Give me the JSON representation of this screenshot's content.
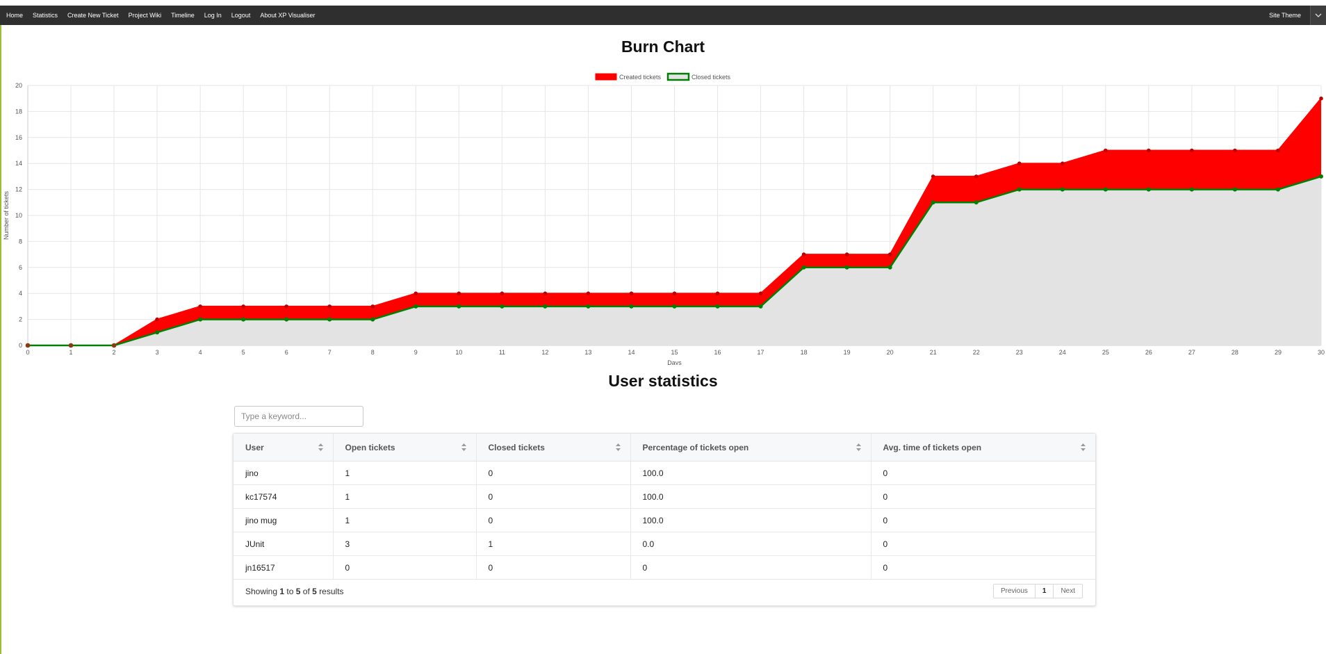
{
  "nav": {
    "items": [
      "Home",
      "Statistics",
      "Create New Ticket",
      "Project Wiki",
      "Timeline",
      "Log In",
      "Logout",
      "About XP Visualiser"
    ],
    "theme_label": "Site Theme"
  },
  "burn_title": "Burn Chart",
  "chart_data": {
    "type": "area",
    "xlabel": "Days",
    "ylabel": "Number of tickets",
    "xlim": [
      0,
      30
    ],
    "ylim": [
      0,
      20
    ],
    "x": [
      0,
      1,
      2,
      3,
      4,
      5,
      6,
      7,
      8,
      9,
      10,
      11,
      12,
      13,
      14,
      15,
      16,
      17,
      18,
      19,
      20,
      21,
      22,
      23,
      24,
      25,
      26,
      27,
      28,
      29,
      30
    ],
    "yticks": [
      0,
      2,
      4,
      6,
      8,
      10,
      12,
      14,
      16,
      18,
      20
    ],
    "series": [
      {
        "name": "Created tickets",
        "color": "#ff0000",
        "values": [
          0,
          0,
          0,
          2,
          3,
          3,
          3,
          3,
          3,
          4,
          4,
          4,
          4,
          4,
          4,
          4,
          4,
          4,
          7,
          7,
          7,
          13,
          13,
          14,
          14,
          15,
          15,
          15,
          15,
          15,
          19
        ]
      },
      {
        "name": "Closed tickets",
        "color": "#008000",
        "values": [
          0,
          0,
          0,
          1,
          2,
          2,
          2,
          2,
          2,
          3,
          3,
          3,
          3,
          3,
          3,
          3,
          3,
          3,
          6,
          6,
          6,
          11,
          11,
          12,
          12,
          12,
          12,
          12,
          12,
          12,
          13
        ]
      }
    ],
    "legend": "top-center",
    "grid": true
  },
  "user_title": "User statistics",
  "search": {
    "placeholder": "Type a keyword..."
  },
  "table": {
    "headers": [
      "User",
      "Open tickets",
      "Closed tickets",
      "Percentage of tickets open",
      "Avg. time of tickets open"
    ],
    "rows": [
      [
        "jino",
        "1",
        "0",
        "100.0",
        "0"
      ],
      [
        "kc17574",
        "1",
        "0",
        "100.0",
        "0"
      ],
      [
        "jino mug",
        "1",
        "0",
        "100.0",
        "0"
      ],
      [
        "JUnit",
        "3",
        "1",
        "0.0",
        "0"
      ],
      [
        "jn16517",
        "0",
        "0",
        "0",
        "0"
      ]
    ]
  },
  "footer": {
    "showing": "Showing",
    "from": "1",
    "to_word": "to",
    "to": "5",
    "of_word": "of",
    "total": "5",
    "results": "results"
  },
  "pager": {
    "previous": "Previous",
    "current": "1",
    "next": "Next"
  }
}
